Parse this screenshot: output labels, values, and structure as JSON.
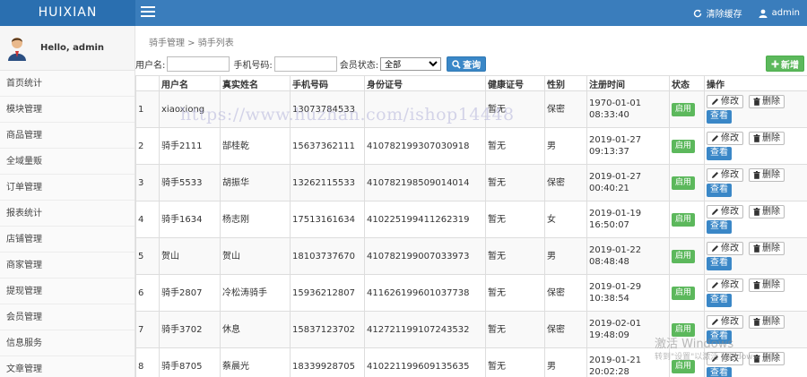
{
  "header": {
    "brand": "HUIXIAN",
    "clear_cache": "清除缓存",
    "user": "admin"
  },
  "sidebar": {
    "hello": "Hello, admin",
    "items": [
      "首页统计",
      "模块管理",
      "商品管理",
      "全域量贩",
      "订单管理",
      "报表统计",
      "店铺管理",
      "商家管理",
      "提现管理",
      "会员管理",
      "信息服务",
      "文章管理"
    ]
  },
  "main": {
    "breadcrumb": "骑手管理 > 骑手列表",
    "search": {
      "username_label": "用户名:",
      "username_value": "",
      "phone_label": "手机号码:",
      "phone_value": "",
      "status_label": "会员状态:",
      "status_selected": "全部",
      "query_button": "查询",
      "add_button": "新增"
    },
    "table": {
      "headers": [
        "",
        "用户名",
        "真实姓名",
        "手机号码",
        "身份证号",
        "健康证号",
        "性别",
        "注册时间",
        "状态",
        "操作"
      ],
      "edit_label": "修改",
      "delete_label": "删除",
      "view_label": "查看",
      "rows": [
        {
          "idx": "1",
          "username": "xiaoxiong",
          "realname": "",
          "phone": "13073784533",
          "idcard": "",
          "health": "暂无",
          "gender": "保密",
          "date": "1970-01-01",
          "time": "08:33:40",
          "status": "启用"
        },
        {
          "idx": "2",
          "username": "骑手2111",
          "realname": "郜桂乾",
          "phone": "15637362111",
          "idcard": "410782199307030918",
          "health": "暂无",
          "gender": "男",
          "date": "2019-01-27",
          "time": "09:13:37",
          "status": "启用"
        },
        {
          "idx": "3",
          "username": "骑手5533",
          "realname": "胡振华",
          "phone": "13262115533",
          "idcard": "410782198509014014",
          "health": "暂无",
          "gender": "保密",
          "date": "2019-01-27",
          "time": "00:40:21",
          "status": "启用"
        },
        {
          "idx": "4",
          "username": "骑手1634",
          "realname": "杨志刚",
          "phone": "17513161634",
          "idcard": "410225199411262319",
          "health": "暂无",
          "gender": "女",
          "date": "2019-01-19",
          "time": "16:50:07",
          "status": "启用"
        },
        {
          "idx": "5",
          "username": "贺山",
          "realname": "贺山",
          "phone": "18103737670",
          "idcard": "410782199007033973",
          "health": "暂无",
          "gender": "男",
          "date": "2019-01-22",
          "time": "08:48:48",
          "status": "启用"
        },
        {
          "idx": "6",
          "username": "骑手2807",
          "realname": "冷松涛骑手",
          "phone": "15936212807",
          "idcard": "411626199601037738",
          "health": "暂无",
          "gender": "保密",
          "date": "2019-01-29",
          "time": "10:38:54",
          "status": "启用"
        },
        {
          "idx": "7",
          "username": "骑手3702",
          "realname": "休息",
          "phone": "15837123702",
          "idcard": "412721199107243532",
          "health": "暂无",
          "gender": "保密",
          "date": "2019-02-01",
          "time": "19:48:09",
          "status": "启用"
        },
        {
          "idx": "8",
          "username": "骑手8705",
          "realname": "蔡晨光",
          "phone": "18339928705",
          "idcard": "410221199609135635",
          "health": "暂无",
          "gender": "男",
          "date": "2019-01-21",
          "time": "20:02:28",
          "status": "启用"
        }
      ]
    }
  },
  "overlay": {
    "watermark": "https://www.huzhan.com/ishop14448",
    "activate_title": "激活 Windows",
    "activate_hint": "转到\"设置\"以激活 Windows。"
  },
  "colors": {
    "topbar": "#3a7dbc",
    "brand_bg": "#2a6fb0",
    "primary_button": "#3a87c7",
    "success": "#5cb85c"
  },
  "icons": {
    "menu": "hamburger-icon",
    "refresh": "refresh-icon",
    "user": "user-icon",
    "search": "search-icon",
    "plus": "plus-icon",
    "edit": "pencil-icon",
    "delete": "trash-icon"
  }
}
